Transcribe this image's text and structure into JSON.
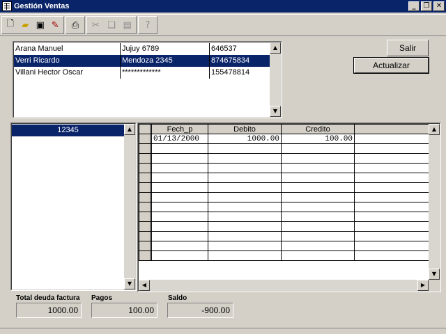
{
  "window": {
    "title": "Gestión Ventas"
  },
  "toolbar": {
    "icons": [
      "new-icon",
      "open-icon",
      "save-icon",
      "edit-icon",
      "print-icon",
      "cut-icon",
      "copy-icon",
      "paste-icon",
      "help-icon"
    ],
    "help_glyph": "?"
  },
  "clients": [
    {
      "name": "Arana Manuel",
      "address": "Jujuy 6789",
      "phone": "646537",
      "selected": false
    },
    {
      "name": "Verri Ricardo",
      "address": "Mendoza 2345",
      "phone": "874675834",
      "selected": true
    },
    {
      "name": "Villani Hector Oscar",
      "address": "*************",
      "phone": "155478814",
      "selected": false
    }
  ],
  "buttons": {
    "exit": "Salir",
    "refresh": "Actualizar"
  },
  "invoices": [
    {
      "number": "12345",
      "selected": true
    }
  ],
  "payments": {
    "columns": [
      "Fech_p",
      "Debito",
      "Credito",
      ""
    ],
    "rows": [
      [
        "01/13/2000",
        "1000.00",
        "100.00",
        ""
      ]
    ]
  },
  "totals": {
    "debt_label": "Total deuda factura",
    "debt_value": "1000.00",
    "payments_label": "Pagos",
    "payments_value": "100.00",
    "balance_label": "Saldo",
    "balance_value": "-900.00"
  }
}
